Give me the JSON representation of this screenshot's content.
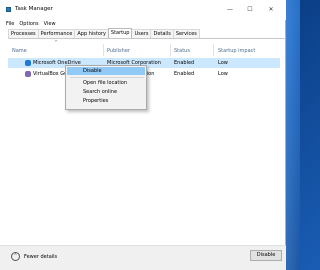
{
  "window": {
    "title": "Task Manager"
  },
  "controls": {
    "minimize": "—",
    "maximize": "☐",
    "close": "✕"
  },
  "menu": [
    "File",
    "Options",
    "View"
  ],
  "tabs": [
    "Processes",
    "Performance",
    "App history",
    "Startup",
    "Users",
    "Details",
    "Services"
  ],
  "active_tab": "Startup",
  "columns": {
    "sort_indicator": "^",
    "name": "Name",
    "publisher": "Publisher",
    "status": "Status",
    "impact": "Startup impact"
  },
  "rows": [
    {
      "name": "Microsoft OneDrive",
      "publisher": "Microsoft Corporation",
      "status": "Enabled",
      "impact": "Low",
      "icon": "onedrive-icon",
      "selected": true
    },
    {
      "name": "VirtualBox Guest Additions",
      "publisher": "Oracle Corporation",
      "status": "Enabled",
      "impact": "Low",
      "icon": "virtualbox-icon",
      "selected": false
    }
  ],
  "context_menu": [
    "Disable",
    "Open file location",
    "Search online",
    "Properties"
  ],
  "footer": {
    "fewer_details": "Fewer details",
    "fewer_icon": "⌃",
    "disable_button": "Disable"
  },
  "colors": {
    "selection": "#cce8ff",
    "menu_highlight": "#91c9f7",
    "desktop": "#1b5fb8"
  }
}
